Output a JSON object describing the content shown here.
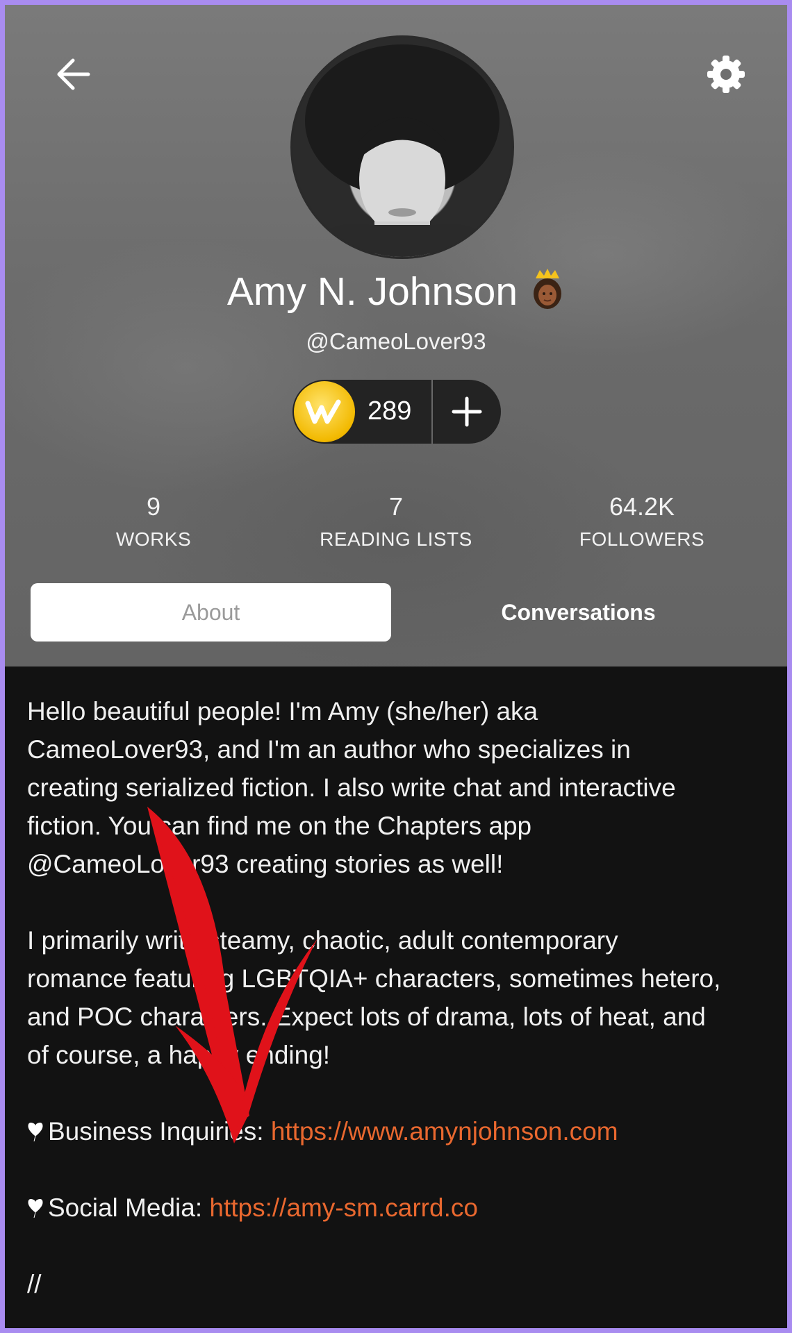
{
  "profile": {
    "name": "Amy N. Johnson",
    "handle": "@CameoLover93",
    "coin_count": "289"
  },
  "icons": {
    "back": "arrow-left-icon",
    "settings": "gear-icon",
    "coin": "wattpad-coin-icon",
    "add": "plus-icon",
    "badge": "princess-emoji-icon"
  },
  "stats": [
    {
      "value": "9",
      "label": "WORKS"
    },
    {
      "value": "7",
      "label": "READING LISTS"
    },
    {
      "value": "64.2K",
      "label": "FOLLOWERS"
    }
  ],
  "tabs": {
    "about": "About",
    "conversations": "Conversations"
  },
  "bio": {
    "para1_lines": [
      "Hello beautiful people! I'm Amy (she/her) aka",
      "CameoLover93, and I'm an author who specializes in",
      "creating serialized fiction. I also write chat  and interactive",
      "fiction. You can find me on the Chapters app",
      "@CameoLover93 creating stories as well!"
    ],
    "para2_lines": [
      "I primarily write steamy, chaotic, adult contemporary",
      "romance featuring LGBTQIA+ characters, sometimes hetero,",
      "and POC characters. Expect lots of drama, lots of heat, and",
      "of course, a happy ending!"
    ],
    "business_label": "Business Inquiries: ",
    "business_url": "https://www.amynjohnson.com",
    "social_label": "Social Media: ",
    "social_url": "https://amy-sm.carrd.co",
    "closing": "//"
  },
  "colors": {
    "frame_border": "#a98cf0",
    "link": "#e9682f",
    "annotation_arrow": "#e0121a",
    "coin": "#f2b900"
  }
}
